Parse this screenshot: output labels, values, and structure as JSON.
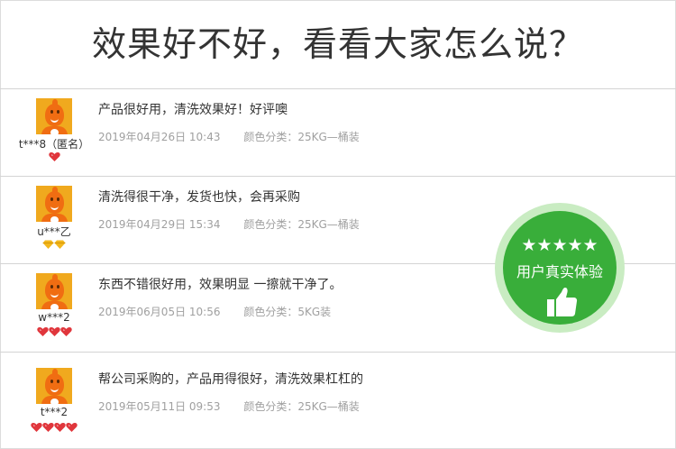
{
  "header": {
    "title": "效果好不好，看看大家怎么说？"
  },
  "badge": {
    "stars": "★★★★★",
    "text": "用户真实体验"
  },
  "reviews": [
    {
      "username": "t***8（匿名）",
      "level": "1 red heart",
      "comment": "产品很好用，清洗效果好！好评噢",
      "date": "2019年04月26日 10:43",
      "spec": "颜色分类：25KG—桶装"
    },
    {
      "username": "u***乙",
      "level": "2 yellow diamonds",
      "comment": "清洗得很干净，发货也快，会再采购",
      "date": "2019年04月29日 15:34",
      "spec": "颜色分类：25KG—桶装"
    },
    {
      "username": "w***2",
      "level": "3 red hearts",
      "comment": "东西不错很好用，效果明显 一擦就干净了。",
      "date": "2019年06月05日 10:56",
      "spec": "颜色分类：5KG装"
    },
    {
      "username": "t***2",
      "level": "4 red hearts",
      "comment": "帮公司采购的，产品用得很好，清洗效果杠杠的",
      "date": "2019年05月11日 09:53",
      "spec": "颜色分类：25KG—桶装"
    }
  ],
  "colors": {
    "badge_green": "#39ae3a",
    "badge_ring": "#c9ecc2",
    "heart_red": "#e0363c",
    "diamond_yellow": "#f3b71c",
    "avatar_bg": "#f0a91e",
    "text_dark": "#333333",
    "text_meta": "#a0a0a0"
  },
  "icons": [
    "avatar-icon",
    "red-heart-level-icon",
    "yellow-diamond-level-icon",
    "thumbs-up-icon"
  ]
}
